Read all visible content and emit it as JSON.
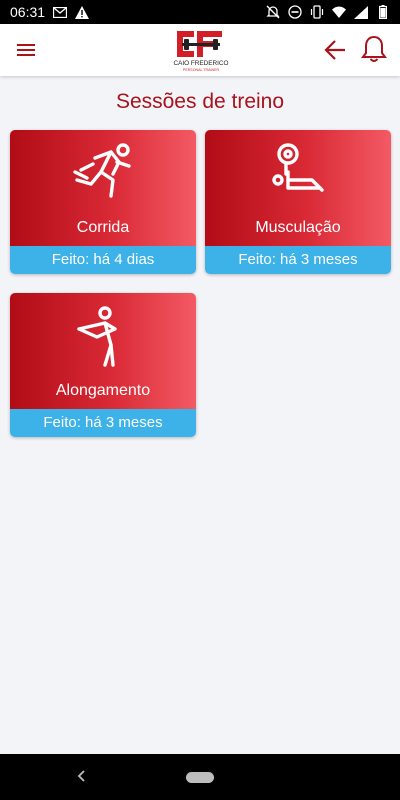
{
  "status_bar": {
    "time": "06:31",
    "left_icons": [
      "gmail-icon",
      "warning-icon"
    ],
    "right_icons": [
      "notifications-off-icon",
      "do-not-disturb-icon",
      "vibrate-icon",
      "wifi-icon",
      "signal-icon",
      "battery-icon"
    ]
  },
  "app_bar": {
    "logo_initials": "CF",
    "logo_name": "CAIO FREDERICO",
    "logo_tagline": "PERSONAL TRAINER"
  },
  "page": {
    "title": "Sessões de treino"
  },
  "sessions": [
    {
      "label": "Corrida",
      "last_done": "Feito: há 4 dias",
      "icon": "running-icon"
    },
    {
      "label": "Musculação",
      "last_done": "Feito: há 3 meses",
      "icon": "weightlifting-icon"
    },
    {
      "label": "Alongamento",
      "last_done": "Feito: há 3 meses",
      "icon": "stretching-icon"
    }
  ],
  "colors": {
    "brand_red": "#a8131c",
    "card_gradient_start": "#b10c16",
    "card_gradient_end": "#f35a64",
    "footer_blue": "#3cb2e8",
    "background": "#f3f4f8"
  }
}
